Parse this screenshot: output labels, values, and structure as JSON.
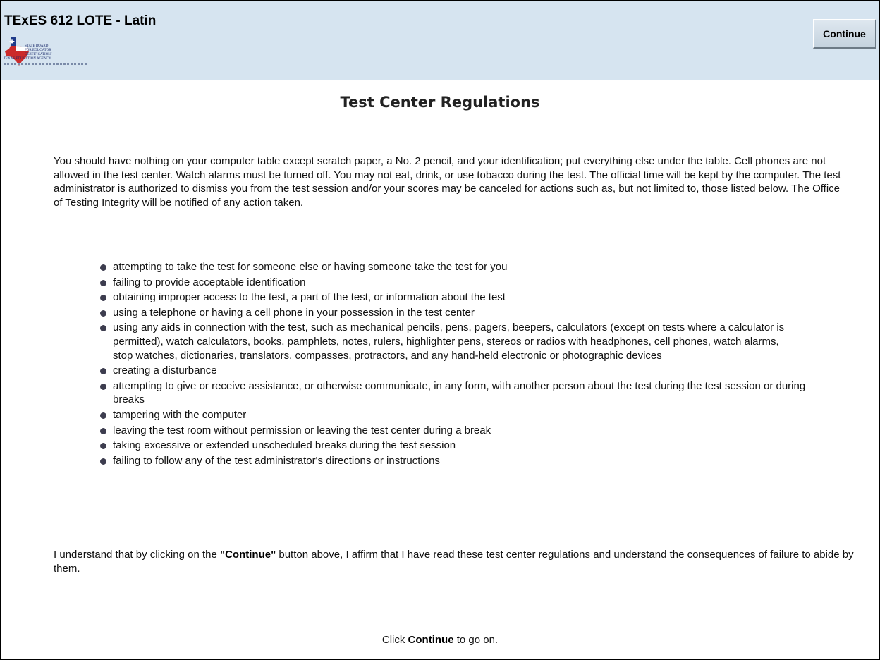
{
  "header": {
    "title": "TExES 612 LOTE - Latin",
    "continue_label": "Continue",
    "logo_lines": [
      "STATE BOARD",
      "FOR EDUCATOR",
      "CERTIFICATION/",
      "TEXAS EDUCATION AGENCY"
    ]
  },
  "main": {
    "heading": "Test Center Regulations",
    "intro": "You should have nothing on your computer table except scratch paper, a No. 2 pencil, and your identification; put everything else under the table. Cell phones are not allowed in the test center. Watch alarms must be turned off. You may not eat, drink, or use tobacco during the test. The official time will be kept by the computer. The test administrator is authorized to dismiss you from the test session and/or your scores may be canceled for actions such as, but not limited to, those listed below. The Office of Testing Integrity will be notified of any action taken.",
    "rules": [
      "attempting to take the test for someone else or having someone take the test for you",
      "failing to provide acceptable identification",
      "obtaining improper access to the test, a part of the test, or information about the test",
      "using a telephone or having a cell phone in your possession in the test center",
      "using any aids in connection with the test, such as mechanical pencils, pens, pagers, beepers, calculators (except on tests where a calculator is permitted), watch calculators, books, pamphlets, notes, rulers, highlighter pens, stereos or radios with headphones, cell phones, watch alarms, stop watches, dictionaries, translators, compasses, protractors, and any hand-held electronic or photographic devices",
      "creating a disturbance",
      "attempting to give or receive assistance, or otherwise communicate, in any form, with another person about the test during the test session or during breaks",
      "tampering with the computer",
      "leaving the test room without permission or leaving the test center during a break",
      "taking excessive or extended unscheduled breaks during the test session",
      "failing to follow any of the test administrator's directions or instructions"
    ],
    "affirm_pre": "I understand that by clicking on the ",
    "affirm_bold": "\"Continue\"",
    "affirm_post": " button above, I affirm that I have read these test center regulations and understand the consequences of failure to abide by them.",
    "footer_pre": "Click ",
    "footer_bold": "Continue",
    "footer_post": " to go on."
  },
  "colors": {
    "header_bg": "#d6e4f0",
    "bullet": "#3d3d4f"
  }
}
